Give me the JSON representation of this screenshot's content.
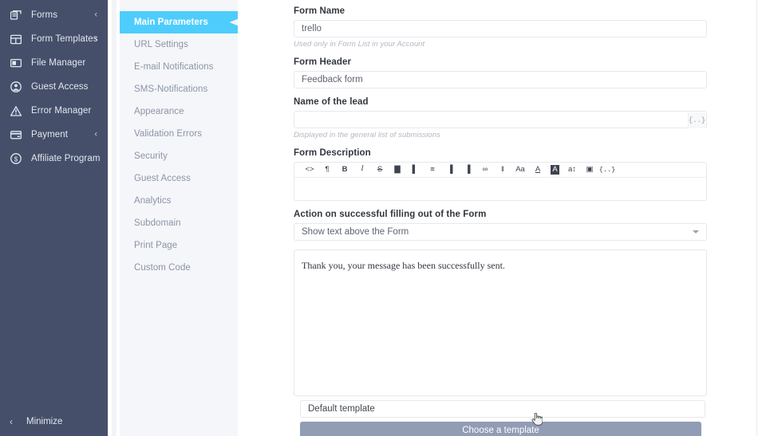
{
  "sidebar": {
    "items": [
      {
        "label": "Forms",
        "icon": "forms-icon",
        "chevron": "‹"
      },
      {
        "label": "Form Templates",
        "icon": "templates-icon",
        "chevron": "‹"
      },
      {
        "label": "File Manager",
        "icon": "file-manager-icon",
        "chevron": ""
      },
      {
        "label": "Guest Access",
        "icon": "user-circle-icon",
        "chevron": ""
      },
      {
        "label": "Error Manager",
        "icon": "warning-icon",
        "chevron": ""
      },
      {
        "label": "Payment",
        "icon": "credit-card-icon",
        "chevron": "‹"
      },
      {
        "label": "Affiliate Program",
        "icon": "dollar-circle-icon",
        "chevron": ""
      }
    ],
    "minimize_label": "Minimize",
    "minimize_icon": "chevron-left-icon",
    "bg_color": "#454f69"
  },
  "submenu": {
    "active_index": 0,
    "active_color": "#4ecdfc",
    "items": [
      {
        "label": "Main Parameters"
      },
      {
        "label": "URL Settings"
      },
      {
        "label": "E-mail Notifications"
      },
      {
        "label": "SMS-Notifications"
      },
      {
        "label": "Appearance"
      },
      {
        "label": "Validation Errors"
      },
      {
        "label": "Security"
      },
      {
        "label": "Guest Access"
      },
      {
        "label": "Analytics"
      },
      {
        "label": "Subdomain"
      },
      {
        "label": "Print Page"
      },
      {
        "label": "Custom Code"
      }
    ]
  },
  "form": {
    "form_name": {
      "label": "Form Name",
      "value": "trello",
      "hint": "Used only in Form List in your Account"
    },
    "form_header": {
      "label": "Form Header",
      "value": "Feedback form"
    },
    "lead_name": {
      "label": "Name of the lead",
      "value": "",
      "placeholder": "",
      "token_glyph": "{..}",
      "hint": "Displayed in the general list of submissions"
    },
    "form_description": {
      "label": "Form Description",
      "value": "",
      "toolbar": [
        {
          "name": "source-code-icon",
          "glyph": "<>"
        },
        {
          "name": "pilcrow-icon",
          "glyph": "¶"
        },
        {
          "name": "bold-icon",
          "glyph": "B"
        },
        {
          "name": "italic-icon",
          "glyph": "I"
        },
        {
          "name": "strikethrough-icon",
          "glyph": "S"
        },
        {
          "name": "align-left-icon",
          "glyph": "▇"
        },
        {
          "name": "indent-left-icon",
          "glyph": "▌"
        },
        {
          "name": "bullet-list-icon",
          "glyph": "≡"
        },
        {
          "name": "indent-increase-icon",
          "glyph": "▐"
        },
        {
          "name": "indent-decrease-icon",
          "glyph": "▐"
        },
        {
          "name": "link-icon",
          "glyph": "∞"
        },
        {
          "name": "table-icon",
          "glyph": "‖"
        },
        {
          "name": "font-size-icon",
          "glyph": "Aa"
        },
        {
          "name": "text-color-icon",
          "glyph": "A"
        },
        {
          "name": "highlight-color-icon",
          "glyph": "A"
        },
        {
          "name": "line-height-icon",
          "glyph": "a↕"
        },
        {
          "name": "insert-image-icon",
          "glyph": "▣"
        },
        {
          "name": "merge-tag-icon",
          "glyph": "{..}"
        }
      ]
    },
    "action": {
      "label": "Action on successful filling out of the Form",
      "selected": "Show text above the Form",
      "options": [
        "Show text above the Form"
      ]
    },
    "success_message": "Thank you, your message has been successfully sent.",
    "template_value": "Default template",
    "choose_template_label": "Choose a template",
    "choose_template_color": "#919cb5"
  }
}
